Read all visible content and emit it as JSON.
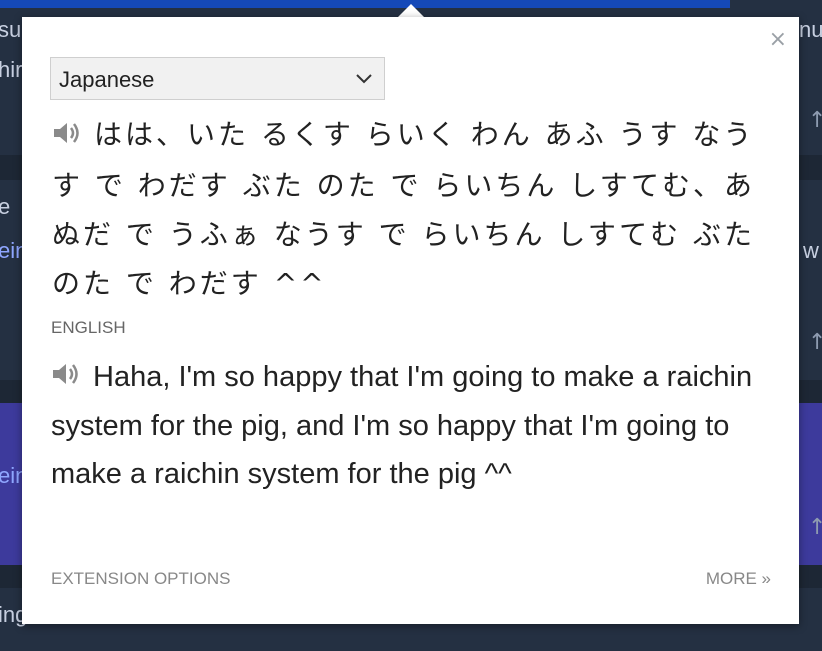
{
  "popup": {
    "close_symbol": "×",
    "language_select": {
      "selected": "Japanese",
      "chevron_icon": "chevron-down-icon"
    },
    "source_text": "はは、いた るくす らいく わん あふ うす なうす で わだす ぶた のた で らいちん しすてむ、あぬだ で うふぁ なうす で らいちん しすてむ ぶた のた で わだす ^^",
    "target_label": "ENGLISH",
    "target_text": "Haha, I'm so happy that I'm going to make a raichin system for the pig, and I'm so happy that I'm going to make a raichin system for the pig ^^",
    "footer": {
      "options": "EXTENSION OPTIONS",
      "more": "MORE »"
    },
    "icons": {
      "speaker": "speaker-icon"
    }
  },
  "background": {
    "fragments": [
      "su",
      "hir",
      "e",
      "ein",
      "ein",
      "ing",
      "nu",
      "w"
    ]
  }
}
